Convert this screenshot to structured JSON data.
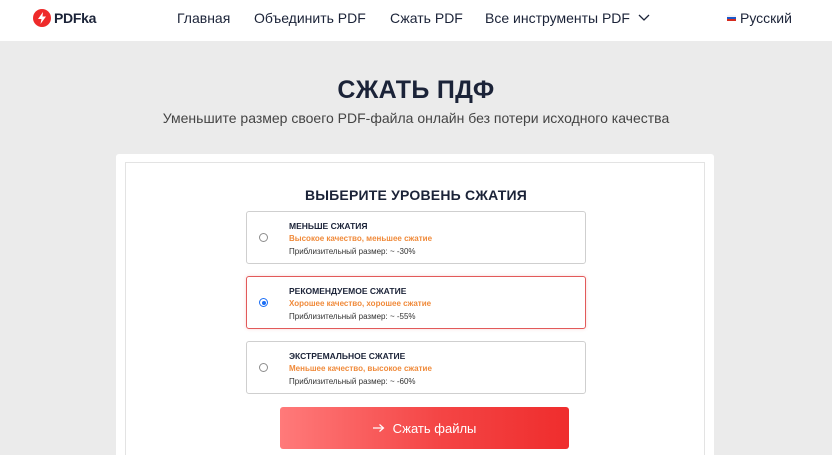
{
  "header": {
    "logo_text": "PDFka",
    "nav": [
      "Главная",
      "Объединить PDF",
      "Сжать PDF",
      "Все инструменты PDF"
    ],
    "language": "Русский",
    "icons": {
      "logo": "bolt-icon",
      "dropdown": "chevron-down-icon",
      "flag": "russia-flag-icon"
    }
  },
  "hero": {
    "title": "СЖАТЬ ПДФ",
    "subtitle": "Уменьшите размер своего PDF-файла онлайн без потери исходного качества"
  },
  "panel": {
    "title": "ВЫБЕРИТЕ УРОВЕНЬ СЖАТИЯ",
    "options": [
      {
        "title": "МЕНЬШЕ СЖАТИЯ",
        "desc": "Высокое качество, меньшее сжатие",
        "size": "Приблизительный размер: ~ -30%",
        "selected": false
      },
      {
        "title": "РЕКОМЕНДУЕМОЕ СЖАТИЕ",
        "desc": "Хорошее качество, хорошее сжатие",
        "size": "Приблизительный размер: ~ -55%",
        "selected": true
      },
      {
        "title": "ЭКСТРЕМАЛЬНОЕ СЖАТИЕ",
        "desc": "Меньшее качество, высокое сжатие",
        "size": "Приблизительный размер: ~ -60%",
        "selected": false
      }
    ],
    "button_label": "Сжать файлы"
  },
  "colors": {
    "accent": "#ef2d2d",
    "highlight_text": "#f08a3a",
    "selected_border": "#e25a5a",
    "radio_selected": "#1b6ef5",
    "page_bg": "#ebebeb",
    "heading": "#1b2338"
  }
}
